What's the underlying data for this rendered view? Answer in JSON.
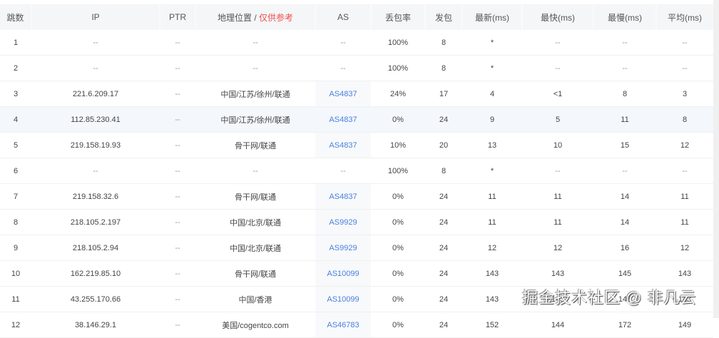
{
  "headers": {
    "hop": "跳数",
    "ip": "IP",
    "ptr": "PTR",
    "geo": "地理位置 / ",
    "geo_note": "仅供参考",
    "as": "AS",
    "loss": "丢包率",
    "sent": "发包",
    "last": "最新(ms)",
    "best": "最快(ms)",
    "worst": "最慢(ms)",
    "avg": "平均(ms)"
  },
  "rows": [
    {
      "hop": "1",
      "ip": "--",
      "ptr": "--",
      "geo": "--",
      "as": "--",
      "loss": "100%",
      "sent": "8",
      "last": "*",
      "best": "--",
      "worst": "--",
      "avg": "--"
    },
    {
      "hop": "2",
      "ip": "--",
      "ptr": "--",
      "geo": "--",
      "as": "--",
      "loss": "100%",
      "sent": "8",
      "last": "*",
      "best": "--",
      "worst": "--",
      "avg": "--"
    },
    {
      "hop": "3",
      "ip": "221.6.209.17",
      "ptr": "--",
      "geo": "中国/江苏/徐州/联通",
      "as": "AS4837",
      "loss": "24%",
      "sent": "17",
      "last": "4",
      "best": "<1",
      "worst": "8",
      "avg": "3"
    },
    {
      "hop": "4",
      "ip": "112.85.230.41",
      "ptr": "--",
      "geo": "中国/江苏/徐州/联通",
      "as": "AS4837",
      "loss": "0%",
      "sent": "24",
      "last": "9",
      "best": "5",
      "worst": "11",
      "avg": "8"
    },
    {
      "hop": "5",
      "ip": "219.158.19.93",
      "ptr": "--",
      "geo": "骨干网/联通",
      "as": "AS4837",
      "loss": "10%",
      "sent": "20",
      "last": "13",
      "best": "10",
      "worst": "15",
      "avg": "12"
    },
    {
      "hop": "6",
      "ip": "--",
      "ptr": "--",
      "geo": "--",
      "as": "--",
      "loss": "100%",
      "sent": "8",
      "last": "*",
      "best": "--",
      "worst": "--",
      "avg": "--"
    },
    {
      "hop": "7",
      "ip": "219.158.32.6",
      "ptr": "--",
      "geo": "骨干网/联通",
      "as": "AS4837",
      "loss": "0%",
      "sent": "24",
      "last": "11",
      "best": "11",
      "worst": "14",
      "avg": "11"
    },
    {
      "hop": "8",
      "ip": "218.105.2.197",
      "ptr": "--",
      "geo": "中国/北京/联通",
      "as": "AS9929",
      "loss": "0%",
      "sent": "24",
      "last": "11",
      "best": "11",
      "worst": "14",
      "avg": "11"
    },
    {
      "hop": "9",
      "ip": "218.105.2.94",
      "ptr": "--",
      "geo": "中国/北京/联通",
      "as": "AS9929",
      "loss": "0%",
      "sent": "24",
      "last": "12",
      "best": "12",
      "worst": "16",
      "avg": "12"
    },
    {
      "hop": "10",
      "ip": "162.219.85.10",
      "ptr": "--",
      "geo": "骨干网/联通",
      "as": "AS10099",
      "loss": "0%",
      "sent": "24",
      "last": "143",
      "best": "143",
      "worst": "145",
      "avg": "143"
    },
    {
      "hop": "11",
      "ip": "43.255.170.66",
      "ptr": "--",
      "geo": "中国/香港",
      "as": "AS10099",
      "loss": "0%",
      "sent": "24",
      "last": "143",
      "best": "143",
      "worst": "143",
      "avg": "143"
    },
    {
      "hop": "12",
      "ip": "38.146.29.1",
      "ptr": "--",
      "geo": "美国/cogentco.com",
      "as": "AS46783",
      "loss": "0%",
      "sent": "24",
      "last": "152",
      "best": "144",
      "worst": "172",
      "avg": "149"
    }
  ],
  "watermark": "掘金技术社区 @ 非凡云"
}
